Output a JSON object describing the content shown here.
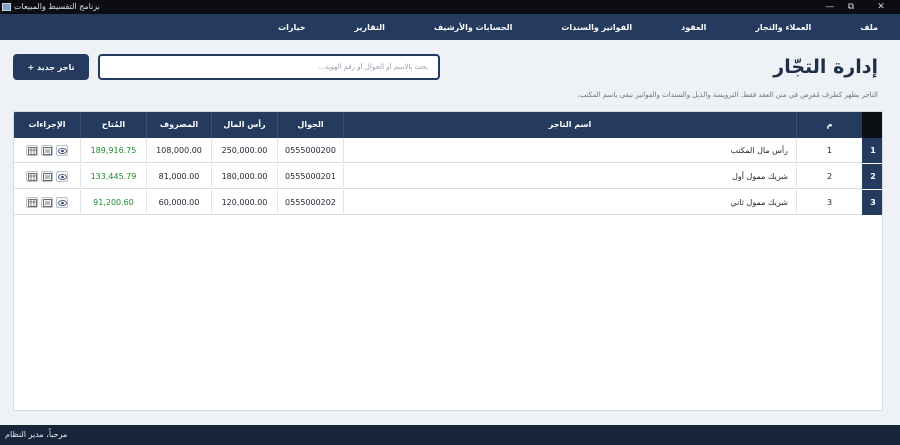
{
  "window": {
    "title": "برنامج التقسيط والمبيعات",
    "controls": {
      "minimize": "—",
      "maximize": "⧉",
      "close": "✕"
    }
  },
  "menu": {
    "items": [
      "ملف",
      "العملاء والتجار",
      "العقود",
      "الفواتير والسندات",
      "الحسابات والأرشيف",
      "التقارير",
      "خيارات"
    ]
  },
  "header": {
    "title": "إدارة التجّار",
    "search_placeholder": "بحث بالاسم أو الجوال أو رقم الهوية...",
    "add_button": "+ تاجر جديد",
    "hint": "التاجر يظهر كطرف مُقرِض في متن العقد فقط. الترويسة والذيل والسندات والفواتير تبقى باسم المكتب."
  },
  "table": {
    "columns": {
      "index": "م",
      "name": "اسم التاجر",
      "phone": "الجوال",
      "capital": "رأس المال",
      "expenses": "المصروف",
      "available": "المُتاح",
      "actions": "الإجراءات"
    },
    "rows": [
      {
        "rownum": "1",
        "index": "1",
        "name": "رأس مال المكتب",
        "phone": "0555000200",
        "capital": "250,000.00",
        "expenses": "108,000.00",
        "available": "189,916.75"
      },
      {
        "rownum": "2",
        "index": "2",
        "name": "شريك ممول أول",
        "phone": "0555000201",
        "capital": "180,000.00",
        "expenses": "81,000.00",
        "available": "133,445.79"
      },
      {
        "rownum": "3",
        "index": "3",
        "name": "شريك ممول ثاني",
        "phone": "0555000202",
        "capital": "120,000.00",
        "expenses": "60,000.00",
        "available": "91,200.60"
      }
    ]
  },
  "status": {
    "text": "مرحباً، مدير النظام"
  },
  "colors": {
    "primary": "#243a5e",
    "profit": "#1f8a2b",
    "background": "#eef1f6"
  }
}
